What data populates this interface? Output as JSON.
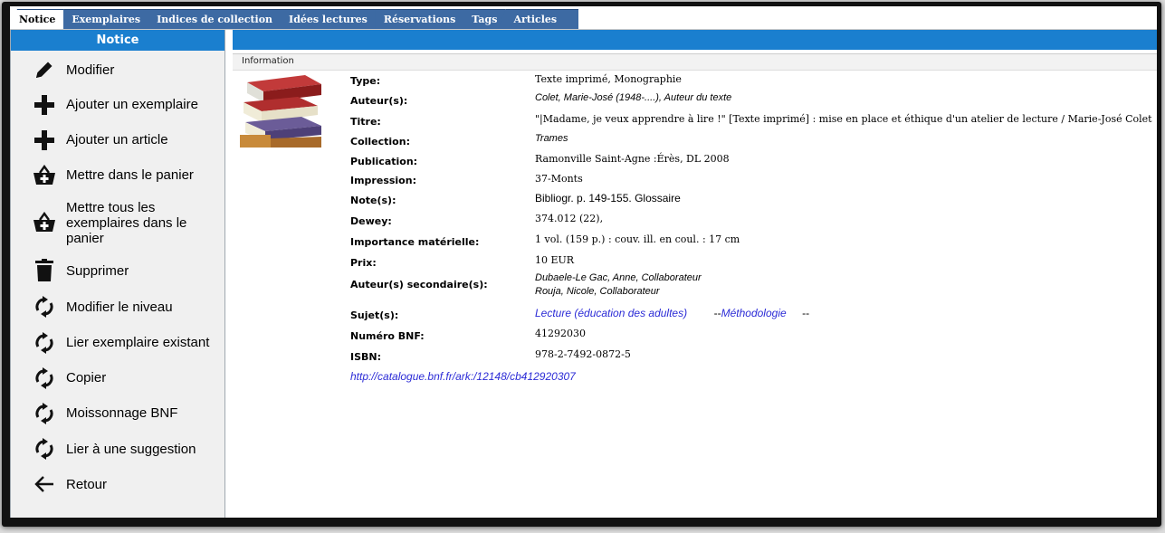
{
  "tabs": [
    {
      "label": "Notice",
      "active": true
    },
    {
      "label": "Exemplaires"
    },
    {
      "label": "Indices de collection"
    },
    {
      "label": "Idées lectures"
    },
    {
      "label": "Réservations"
    },
    {
      "label": "Tags"
    },
    {
      "label": "Articles"
    }
  ],
  "sidebar": {
    "title": "Notice",
    "items": [
      {
        "label": "Modifier",
        "icon": "pencil-icon"
      },
      {
        "label": "Ajouter un exemplaire",
        "icon": "plus-icon"
      },
      {
        "label": "Ajouter un article",
        "icon": "plus-icon"
      },
      {
        "label": "Mettre dans le panier",
        "icon": "basket-add-icon"
      },
      {
        "label": "Mettre tous les exemplaires dans le panier",
        "icon": "basket-add-icon"
      },
      {
        "label": "Supprimer",
        "icon": "trash-icon"
      },
      {
        "label": "Modifier le niveau",
        "icon": "refresh-icon"
      },
      {
        "label": "Lier exemplaire existant",
        "icon": "refresh-icon"
      },
      {
        "label": "Copier",
        "icon": "refresh-icon"
      },
      {
        "label": "Moissonnage BNF",
        "icon": "refresh-icon"
      },
      {
        "label": "Lier à une suggestion",
        "icon": "refresh-icon"
      },
      {
        "label": "Retour",
        "icon": "arrow-left-icon"
      }
    ]
  },
  "main": {
    "section_label": "Information",
    "fields": {
      "type_label": "Type:",
      "type_value": "Texte imprimé, Monographie",
      "auteurs_label": "Auteur(s):",
      "auteurs_value": "Colet, Marie-José (1948-....), Auteur du texte",
      "titre_label": "Titre:",
      "titre_value": "\"|Madame, je veux apprendre à lire !\" [Texte imprimé] : mise en place et éthique d'un atelier de lecture / Marie-José Colet",
      "collection_label": "Collection:",
      "collection_value": "Trames",
      "publication_label": "Publication:",
      "publication_value": "Ramonville Saint-Agne :Érès, DL 2008",
      "impression_label": "Impression:",
      "impression_value": "37-Monts",
      "notes_label": "Note(s):",
      "notes_value": "Bibliogr. p. 149-155. Glossaire",
      "dewey_label": "Dewey:",
      "dewey_value": "374.012 (22),",
      "importance_label": "Importance matérielle:",
      "importance_value": "1 vol. (159 p.) : couv. ill. en coul. : 17 cm",
      "prix_label": "Prix:",
      "prix_value": "10 EUR",
      "secondaires_label": "Auteur(s) secondaire(s):",
      "secondaire_1": "Dubaele-Le Gac, Anne, Collaborateur",
      "secondaire_2": "Rouja, Nicole, Collaborateur",
      "sujets_label": "Sujet(s):",
      "sujet_1": "Lecture (éducation des adultes)",
      "sujet_sep": "--",
      "sujet_2": "Méthodologie",
      "sujet_end": "--",
      "bnf_label": "Numéro BNF:",
      "bnf_value": "41292030",
      "isbn_label": "ISBN:",
      "isbn_value": "978-2-7492-0872-5",
      "catalogue_link": "http://catalogue.bnf.fr/ark:/12148/cb412920307"
    }
  },
  "colors": {
    "accent_blue": "#1a7fcf",
    "tab_blue": "#3d6aa3",
    "link_blue": "#2b2bd6"
  }
}
